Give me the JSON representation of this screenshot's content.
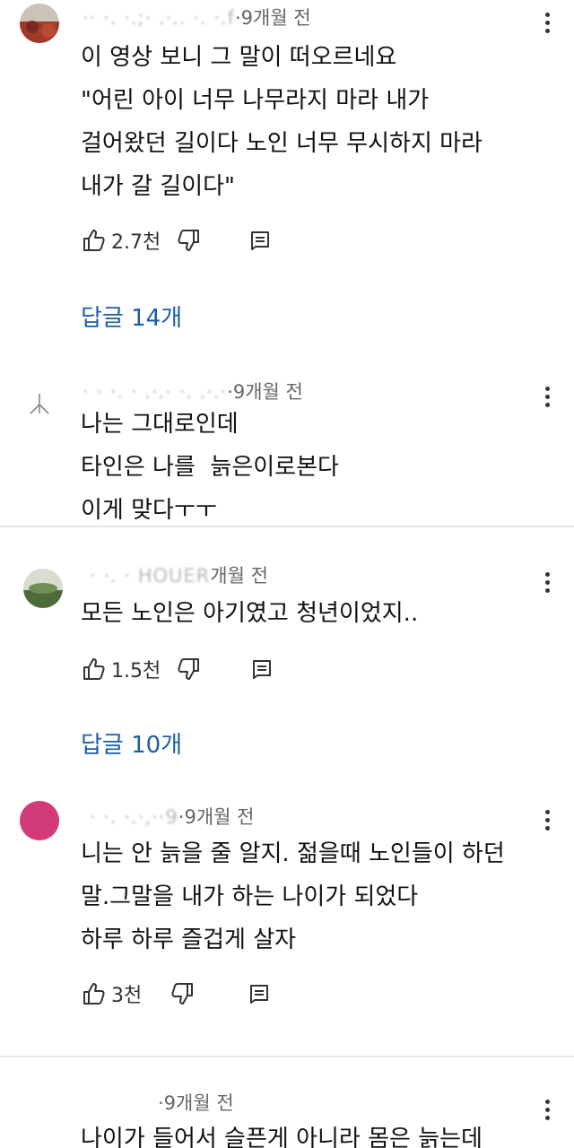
{
  "comments": [
    {
      "author": "·· ·. ·.;· .·.. ·. ·.f",
      "time": "·9개월 전",
      "lines": [
        "이 영상 보니 그 말이 떠오르네요",
        "\"어린 아이 너무 나무라지 마라 내가",
        "걸어왔던 길이다 노인 너무 무시하지 마라",
        "내가 갈 길이다\""
      ],
      "likes": "2.7천",
      "replies": "답글 14개"
    },
    {
      "author": "· · ·. · .·.· ·. .·.·",
      "time": "·9개월 전",
      "lines": [
        "나는 그대로인데",
        "타인은 나를  늙은이로본다",
        "이게 맞다ㅜㅜ"
      ]
    },
    {
      "author": "· ·. · HOUER",
      "time": "개월 전",
      "lines": [
        "모든 노인은 아기였고 청년이었지.."
      ],
      "likes": "1.5천",
      "replies": "답글 10개"
    },
    {
      "author": "· ·. ·.·,··9",
      "time": "·9개월 전",
      "lines": [
        "니는 안 늙을 줄 알지. 젊을때 노인들이 하던",
        "말.그말을 내가 하는 나이가 되었다",
        "하루 하루 즐겁게 살자"
      ],
      "likes": "3천"
    },
    {
      "author": "",
      "time": "·9개월 전",
      "lines": [
        "나이가 들어서 슬픈게 아니라 몸은 늙는데"
      ]
    }
  ],
  "icons": {
    "like": "thumb-up-icon",
    "dislike": "thumb-down-icon",
    "reply": "comment-icon",
    "more": "more-vertical-icon"
  },
  "colors": {
    "link": "#1a5ea8",
    "meta": "#666666"
  }
}
